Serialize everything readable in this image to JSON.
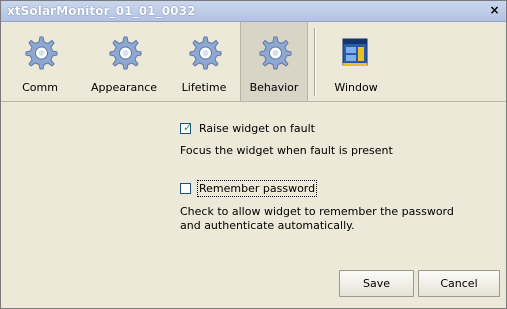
{
  "window": {
    "title": "xtSolarMonitor_01_01_0032",
    "close_glyph": "×"
  },
  "toolbar": {
    "tabs": [
      {
        "label": "Comm",
        "icon": "gear-icon"
      },
      {
        "label": "Appearance",
        "icon": "gear-icon"
      },
      {
        "label": "Lifetime",
        "icon": "gear-icon"
      },
      {
        "label": "Behavior",
        "icon": "gear-icon",
        "selected": true
      },
      {
        "label": "Window",
        "icon": "window-icon"
      }
    ]
  },
  "behavior": {
    "raise_widget": {
      "label": "Raise widget on fault",
      "checked": true,
      "description": "Focus the widget when fault is present"
    },
    "remember_password": {
      "label": "Remember password",
      "checked": false,
      "description_line1": "Check to allow widget to remember the password",
      "description_line2": "and authenticate automatically."
    }
  },
  "buttons": {
    "save": "Save",
    "cancel": "Cancel"
  },
  "colors": {
    "gear": "#8fa8d2",
    "window_icon_blue": "#2a5aa8",
    "window_icon_yellow": "#e8c02a"
  }
}
